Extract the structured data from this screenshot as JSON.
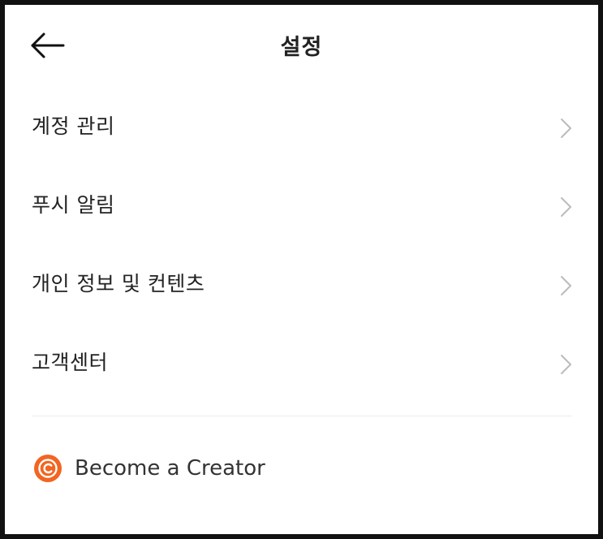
{
  "header": {
    "title": "설정",
    "back_icon": "arrow-left-icon"
  },
  "menu": {
    "items": [
      {
        "label": "계정 관리",
        "icon": "chevron-right-icon"
      },
      {
        "label": "푸시 알림",
        "icon": "chevron-right-icon"
      },
      {
        "label": "개인 정보 및 컨텐츠",
        "icon": "chevron-right-icon"
      },
      {
        "label": "고객센터",
        "icon": "chevron-right-icon"
      }
    ]
  },
  "creator": {
    "label": "Become a Creator",
    "icon": "creator-c-icon",
    "accent_color": "#F26522"
  },
  "colors": {
    "background": "#FFFFFF",
    "text": "#222222",
    "chevron": "#BBBBBB",
    "divider": "#ECECEC",
    "frame": "#111111"
  }
}
